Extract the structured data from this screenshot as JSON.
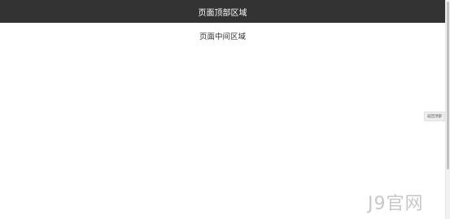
{
  "header": {
    "title": "页面顶部区域"
  },
  "main": {
    "text": "页面中间区域"
  },
  "back_to_top": {
    "label": "返回顶部"
  },
  "watermark": {
    "text": "J9官网"
  },
  "colors": {
    "header_bg": "#333333",
    "header_text": "#ffffff",
    "body_bg": "#ffffff"
  }
}
